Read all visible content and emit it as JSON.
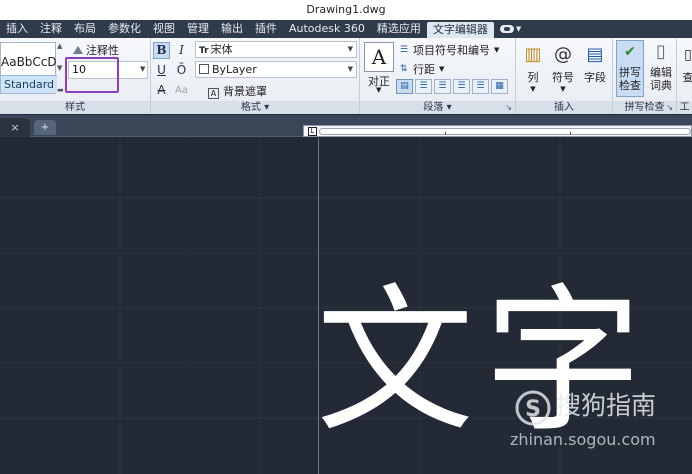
{
  "window": {
    "title": "Drawing1.dwg"
  },
  "menu_tabs": [
    {
      "label": "插入"
    },
    {
      "label": "注释"
    },
    {
      "label": "布局"
    },
    {
      "label": "参数化"
    },
    {
      "label": "视图"
    },
    {
      "label": "管理"
    },
    {
      "label": "输出"
    },
    {
      "label": "插件"
    },
    {
      "label": "Autodesk 360"
    },
    {
      "label": "精选应用"
    },
    {
      "label": "文字编辑器",
      "active": true
    }
  ],
  "style_panel": {
    "preview_sample": "AaBbCcD",
    "preview_style": "Standard",
    "annotative_label": "注释性",
    "text_height": "10",
    "title": "样式"
  },
  "format_panel": {
    "bold": "B",
    "italic": "I",
    "underline": "U",
    "overline": "Ō",
    "strike": "A",
    "case": "Aa",
    "font": "宋体",
    "font_prefix": "Tr",
    "color": "ByLayer",
    "background_mask": "背景遮罩",
    "title": "格式"
  },
  "paragraph_panel": {
    "justify_label": "对正",
    "bullets_label": "项目符号和编号",
    "line_spacing_label": "行距",
    "title": "段落"
  },
  "insert_panel": {
    "column_label": "列",
    "symbol_label": "符号",
    "field_label": "字段",
    "title": "插入"
  },
  "spell_panel": {
    "spell_check_label": "拼写\n检查",
    "edit_dictionary_label": "编辑\n词典",
    "title": "拼写检查"
  },
  "tools_panel": {
    "find_label_partial": "查",
    "title": "工"
  },
  "document_tabs": {
    "close_glyph": "×",
    "new_tab_glyph": "+"
  },
  "canvas": {
    "editor_text": "文字"
  },
  "watermark": {
    "brand": "搜狗指南",
    "url": "zhinan.sogou.com"
  },
  "colors": {
    "canvas_bg": "#232a35",
    "accent": "#8b3fb8",
    "ribbon_bg": "#eef2f6"
  }
}
